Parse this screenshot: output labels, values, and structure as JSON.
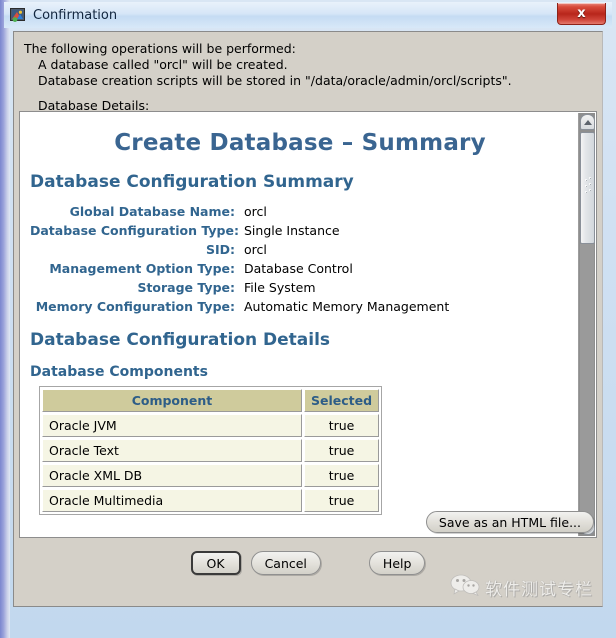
{
  "window": {
    "title": "Confirmation",
    "icon": "app-icon",
    "close_label": "x"
  },
  "intro": {
    "line1": "The following operations will be performed:",
    "line2": "A database called \"orcl\" will be created.",
    "line3": "Database creation scripts will be stored in \"/data/oracle/admin/orcl/scripts\".",
    "line4": "Database Details:"
  },
  "document": {
    "title": "Create Database – Summary",
    "section_summary": "Database Configuration Summary",
    "section_details": "Database Configuration Details",
    "section_components": "Database Components",
    "summary_rows": [
      {
        "key": "Global Database Name:",
        "value": "orcl"
      },
      {
        "key": "Database Configuration Type:",
        "value": "Single Instance"
      },
      {
        "key": "SID:",
        "value": "orcl"
      },
      {
        "key": "Management Option Type:",
        "value": "Database Control"
      },
      {
        "key": "Storage Type:",
        "value": "File System"
      },
      {
        "key": "Memory Configuration Type:",
        "value": "Automatic Memory Management"
      }
    ],
    "components_table": {
      "headers": [
        "Component",
        "Selected"
      ],
      "rows": [
        [
          "Oracle JVM",
          "true"
        ],
        [
          "Oracle Text",
          "true"
        ],
        [
          "Oracle XML DB",
          "true"
        ],
        [
          "Oracle Multimedia",
          "true"
        ]
      ]
    }
  },
  "buttons": {
    "save_html": "Save as an HTML file...",
    "ok": "OK",
    "cancel": "Cancel",
    "help": "Help"
  },
  "watermark": {
    "text": "软件测试专栏"
  },
  "colors": {
    "heading_blue": "#31658f",
    "title_blue": "#3a6591",
    "table_header_bg": "#cfcb9c",
    "table_row_bg": "#f5f5e4",
    "dialog_gray": "#d4d0c8",
    "close_red": "#b8261b"
  }
}
